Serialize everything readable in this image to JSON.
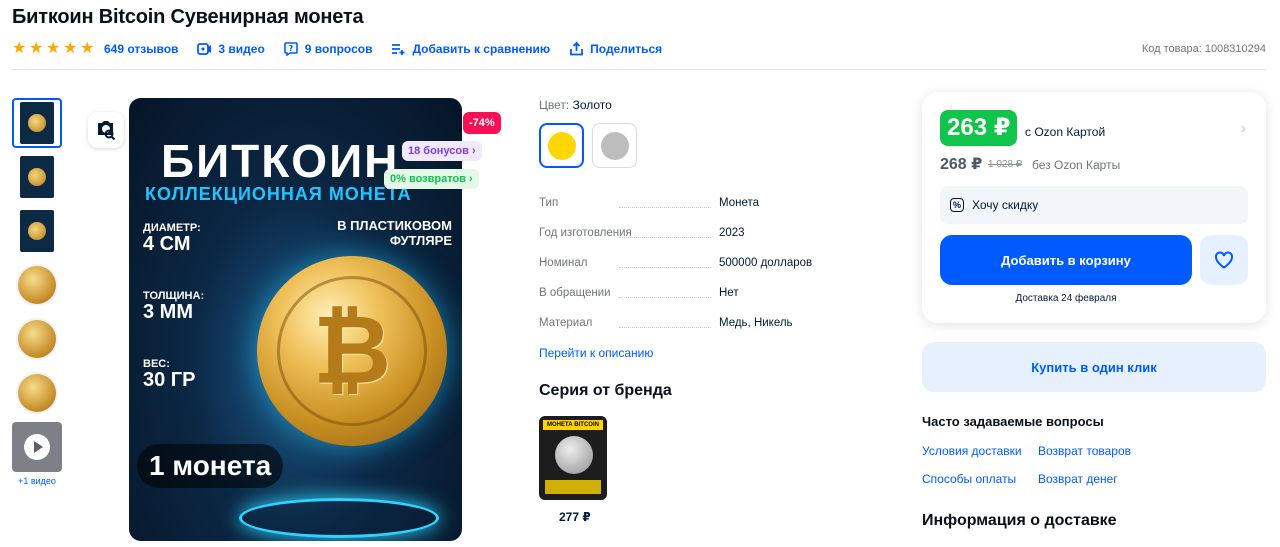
{
  "product": {
    "title": "Биткоин Bitcoin Сувенирная монета",
    "sku_label": "Код товара: 1008310294"
  },
  "meta": {
    "stars": 5,
    "reviews": "649 отзывов",
    "videos": "3 видео",
    "questions": "9 вопросов",
    "compare": "Добавить к сравнению",
    "share": "Поделиться"
  },
  "gallery": {
    "video_caption": "+1 видео",
    "thumb_count": 6
  },
  "image": {
    "title": "БИТКОИН",
    "subtitle": "КОЛЛЕКЦИОННАЯ МОНЕТА",
    "diameter_label": "ДИАМЕТР:",
    "diameter_value": "4 СМ",
    "thickness_label": "ТОЛЩИНА:",
    "thickness_value": "3 ММ",
    "weight_label": "ВЕС:",
    "weight_value": "30 ГР",
    "case_line1": "В ПЛАСТИКОВОМ",
    "case_line2": "ФУТЛЯРЕ",
    "quantity": "1 монета",
    "coin_symbol": "₿"
  },
  "badges": {
    "discount": "-74%",
    "bonus": "18 бонусов ›",
    "returns": "0% возвратов ›"
  },
  "variant": {
    "color_label": "Цвет:",
    "color_value": "Золото",
    "swatches": [
      "#ffd600",
      "#bdbdbd"
    ]
  },
  "specs": [
    {
      "key": "Тип",
      "value": "Монета"
    },
    {
      "key": "Год изготовления",
      "value": "2023"
    },
    {
      "key": "Номинал",
      "value": "500000 долларов"
    },
    {
      "key": "В обращении",
      "value": "Нет"
    },
    {
      "key": "Материал",
      "value": "Медь, Никель"
    }
  ],
  "links": {
    "goto_description": "Перейти к описанию"
  },
  "series": {
    "title": "Серия от бренда",
    "card_header": "МОНЕТА BITCOIN",
    "price": "277 ₽"
  },
  "buy": {
    "price_card": "263 ₽",
    "price_card_note": "с Ozon Картой",
    "price_regular": "268 ₽",
    "price_old": "1 028 ₽",
    "price_regular_note": "без Ozon Карты",
    "want_discount": "Хочу скидку",
    "add_to_cart": "Добавить в корзину",
    "delivery": "Доставка 24 февраля",
    "one_click": "Купить в один клик"
  },
  "faq": {
    "title": "Часто задаваемые вопросы",
    "items": [
      "Условия доставки",
      "Возврат товаров",
      "Способы оплаты",
      "Возврат денег"
    ]
  },
  "delivery_info": {
    "title": "Информация о доставке"
  },
  "colors": {
    "accent": "#005bff",
    "price_green": "#10c44c",
    "discount_pink": "#f91155",
    "star": "#ffa800"
  }
}
